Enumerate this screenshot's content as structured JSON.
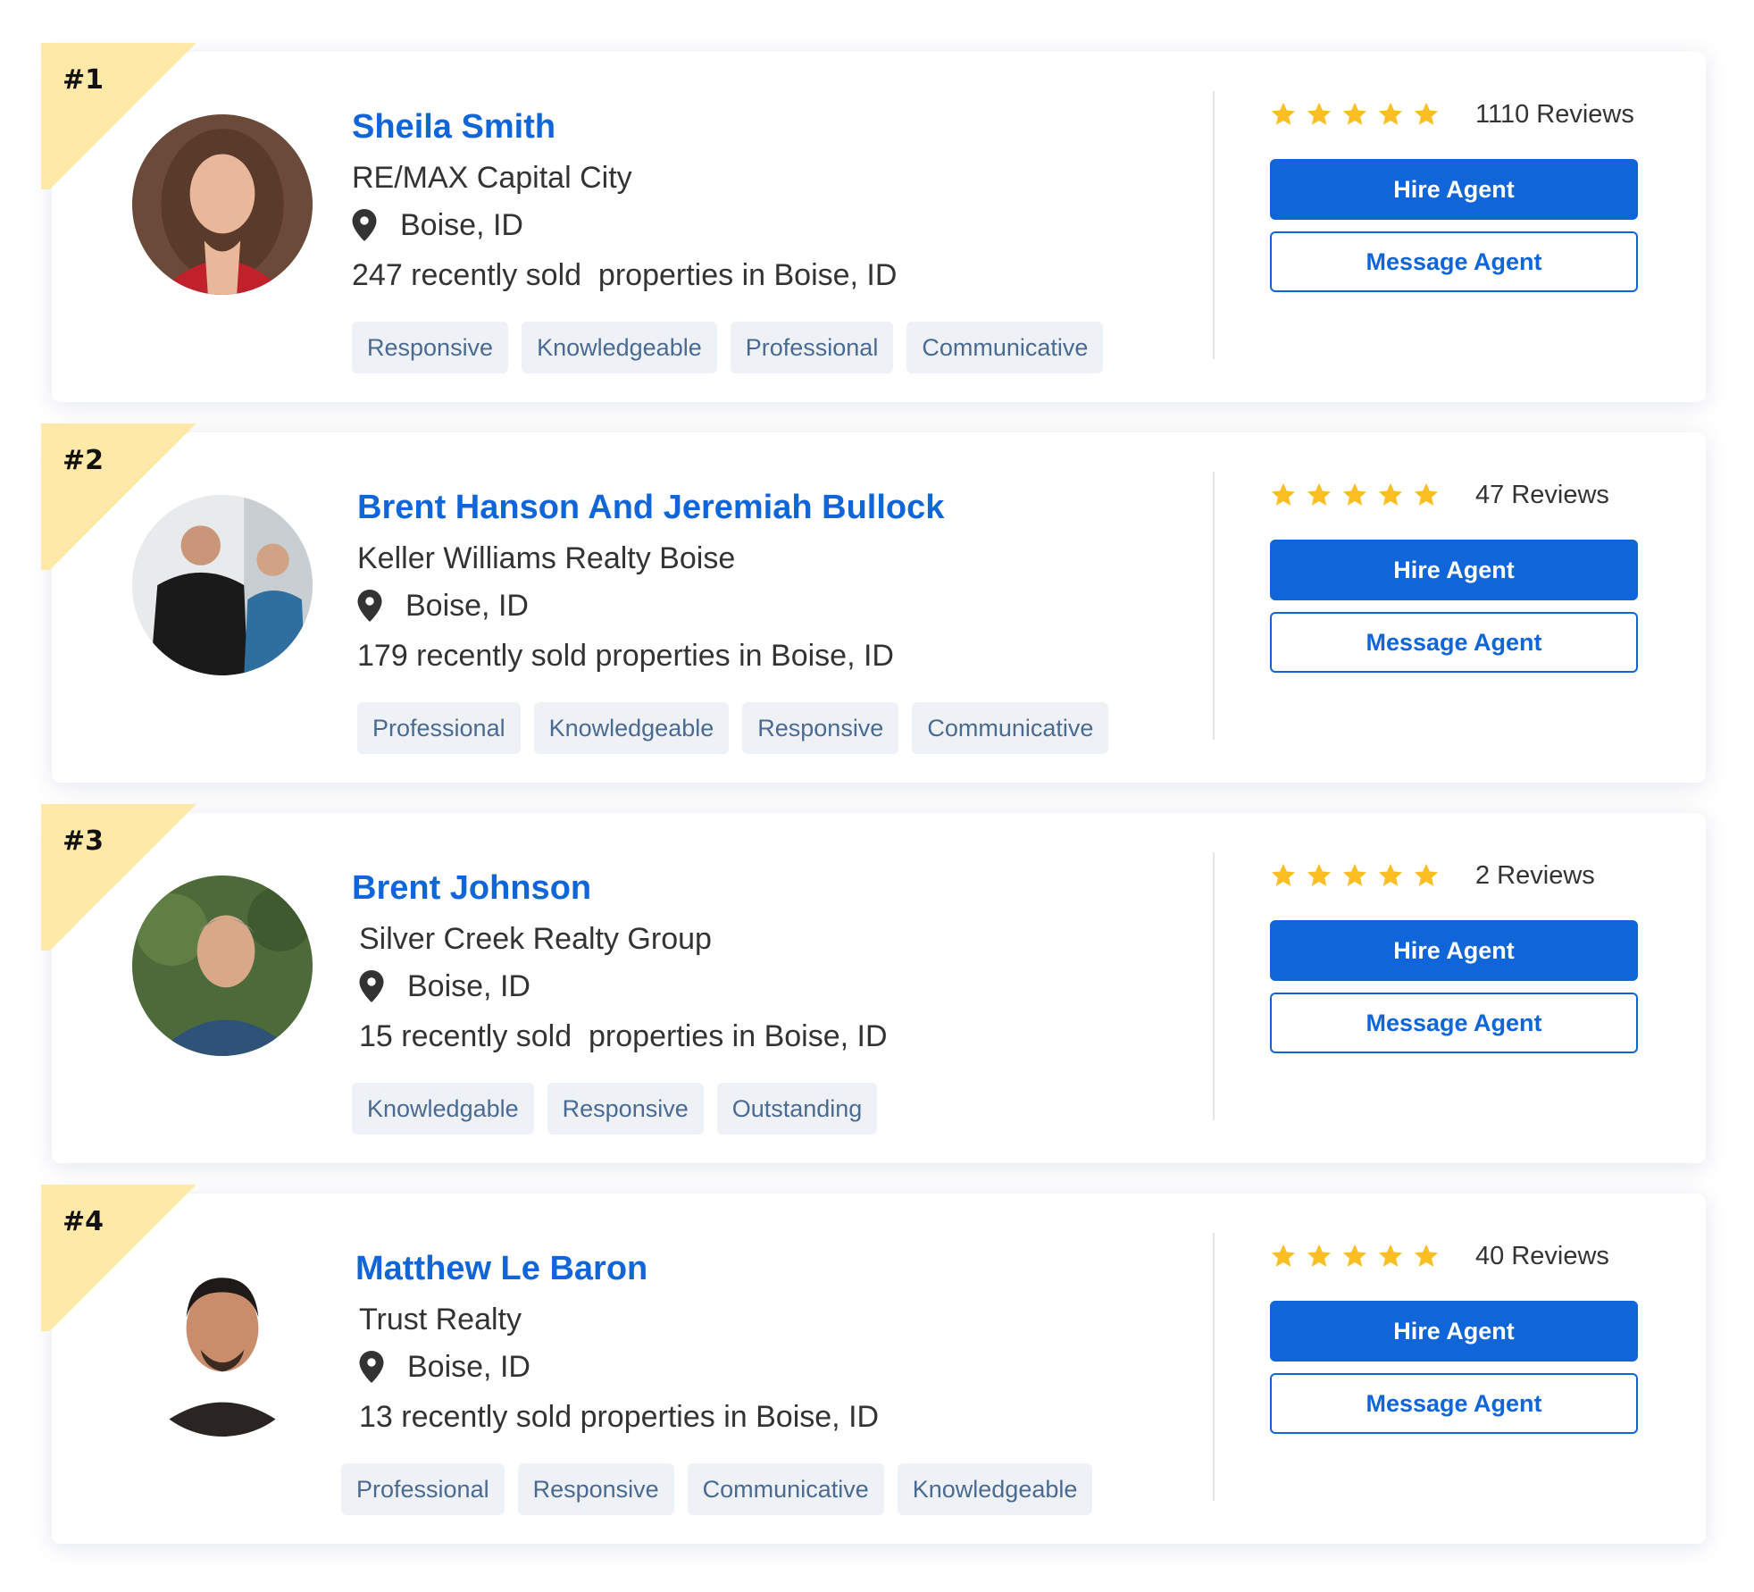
{
  "colors": {
    "accent": "#1066d9",
    "rank_badge": "#ffe9a8",
    "star": "#fbbf24",
    "tag_bg": "#eef2f7",
    "tag_text": "#4b6a91"
  },
  "icons": {
    "location": "map-pin-icon",
    "rating": "star-icon"
  },
  "agents": [
    {
      "rank": "#1",
      "name": "Sheila Smith",
      "brokerage": "RE/MAX Capital City",
      "location": "Boise, ID",
      "sold": "247 recently sold  properties in Boise, ID",
      "tags": [
        "Responsive",
        "Knowledgeable",
        "Professional",
        "Communicative"
      ],
      "stars": 5,
      "reviews": "1110 Reviews",
      "hire_label": "Hire Agent",
      "message_label": "Message Agent"
    },
    {
      "rank": "#2",
      "name": "Brent Hanson And Jeremiah Bullock",
      "brokerage": "Keller Williams Realty Boise",
      "location": "Boise, ID",
      "sold": "179 recently sold properties in Boise, ID",
      "tags": [
        "Professional",
        "Knowledgeable",
        "Responsive",
        "Communicative"
      ],
      "stars": 5,
      "reviews": "47 Reviews",
      "hire_label": "Hire Agent",
      "message_label": "Message Agent"
    },
    {
      "rank": "#3",
      "name": "Brent Johnson",
      "brokerage": "Silver Creek Realty Group",
      "location": "Boise, ID",
      "sold": "15 recently sold  properties in Boise, ID",
      "tags": [
        "Knowledgable",
        "Responsive",
        "Outstanding"
      ],
      "stars": 5,
      "reviews": "2 Reviews",
      "hire_label": "Hire Agent",
      "message_label": "Message Agent"
    },
    {
      "rank": "#4",
      "name": "Matthew Le Baron",
      "brokerage": "Trust Realty",
      "location": "Boise, ID",
      "sold": "13 recently sold properties in Boise, ID",
      "tags": [
        "Professional",
        "Responsive",
        "Communicative",
        "Knowledgeable"
      ],
      "stars": 5,
      "reviews": "40 Reviews",
      "hire_label": "Hire Agent",
      "message_label": "Message Agent"
    }
  ]
}
